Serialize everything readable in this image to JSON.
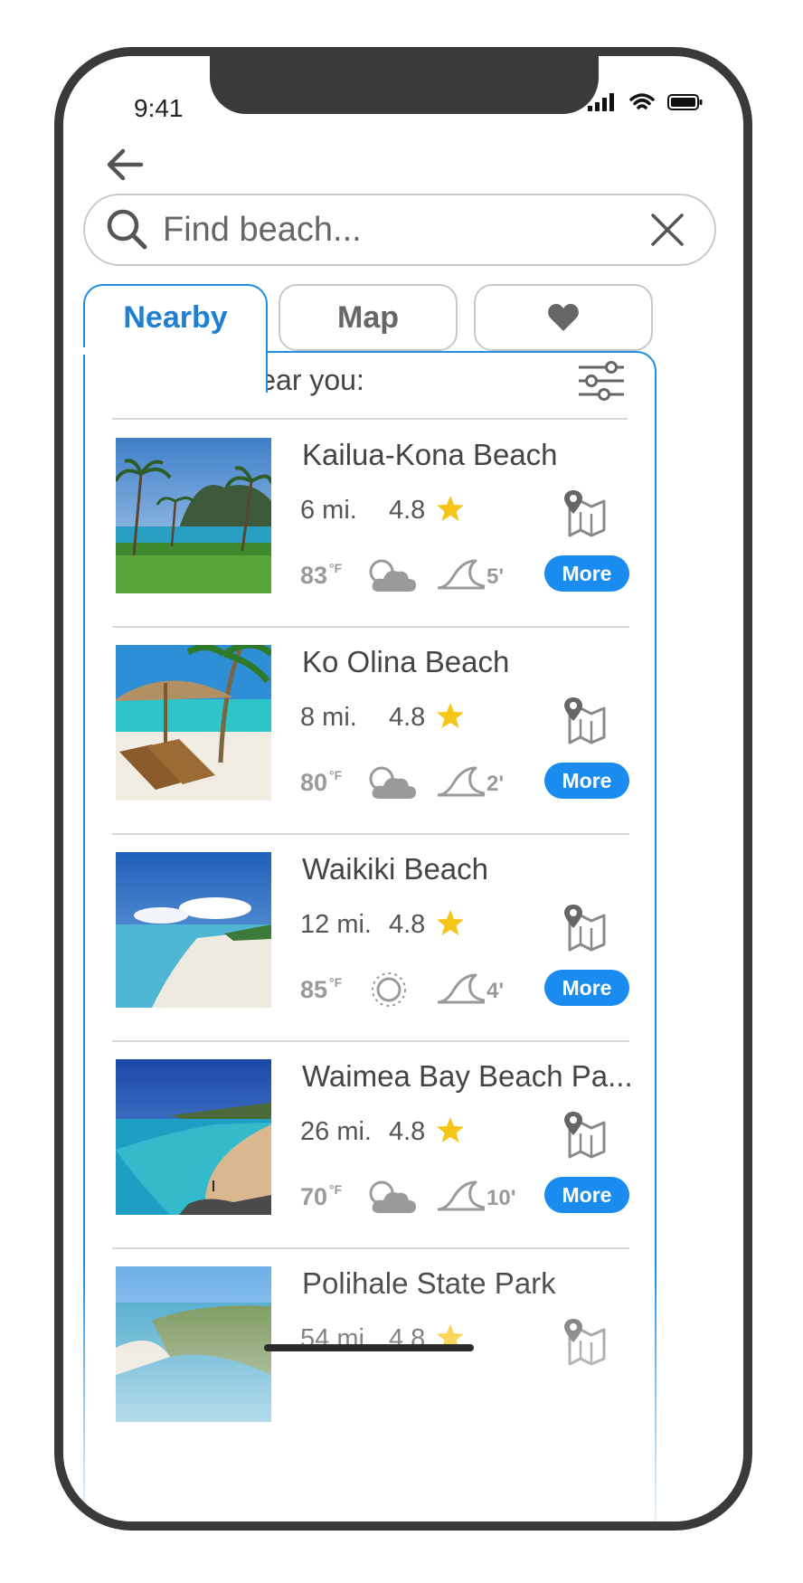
{
  "status_bar": {
    "time": "9:41"
  },
  "search": {
    "placeholder": "Find beach...",
    "value": ""
  },
  "tabs": {
    "nearby": "Nearby",
    "map": "Map"
  },
  "list_header": "Beaches near you:",
  "accent_color": "#1a8cf0",
  "beaches": [
    {
      "name": "Kailua-Kona Beach",
      "distance": "6 mi.",
      "rating": "4.8",
      "temperature": "83",
      "temp_unit": "°F",
      "weather": "cloudy-icon",
      "swell": "5'",
      "more": "More"
    },
    {
      "name": "Ko Olina Beach",
      "distance": "8 mi.",
      "rating": "4.8",
      "temperature": "80",
      "temp_unit": "°F",
      "weather": "cloudy-icon",
      "swell": "2'",
      "more": "More"
    },
    {
      "name": "Waikiki Beach",
      "distance": "12 mi.",
      "rating": "4.8",
      "temperature": "85",
      "temp_unit": "°F",
      "weather": "sunny-icon",
      "swell": "4'",
      "more": "More"
    },
    {
      "name": "Waimea Bay Beach Pa...",
      "distance": "26 mi.",
      "rating": "4.8",
      "temperature": "70",
      "temp_unit": "°F",
      "weather": "cloudy-icon",
      "swell": "10'",
      "more": "More"
    },
    {
      "name": "Polihale State Park",
      "distance": "54 mi.",
      "rating": "4.8"
    }
  ]
}
